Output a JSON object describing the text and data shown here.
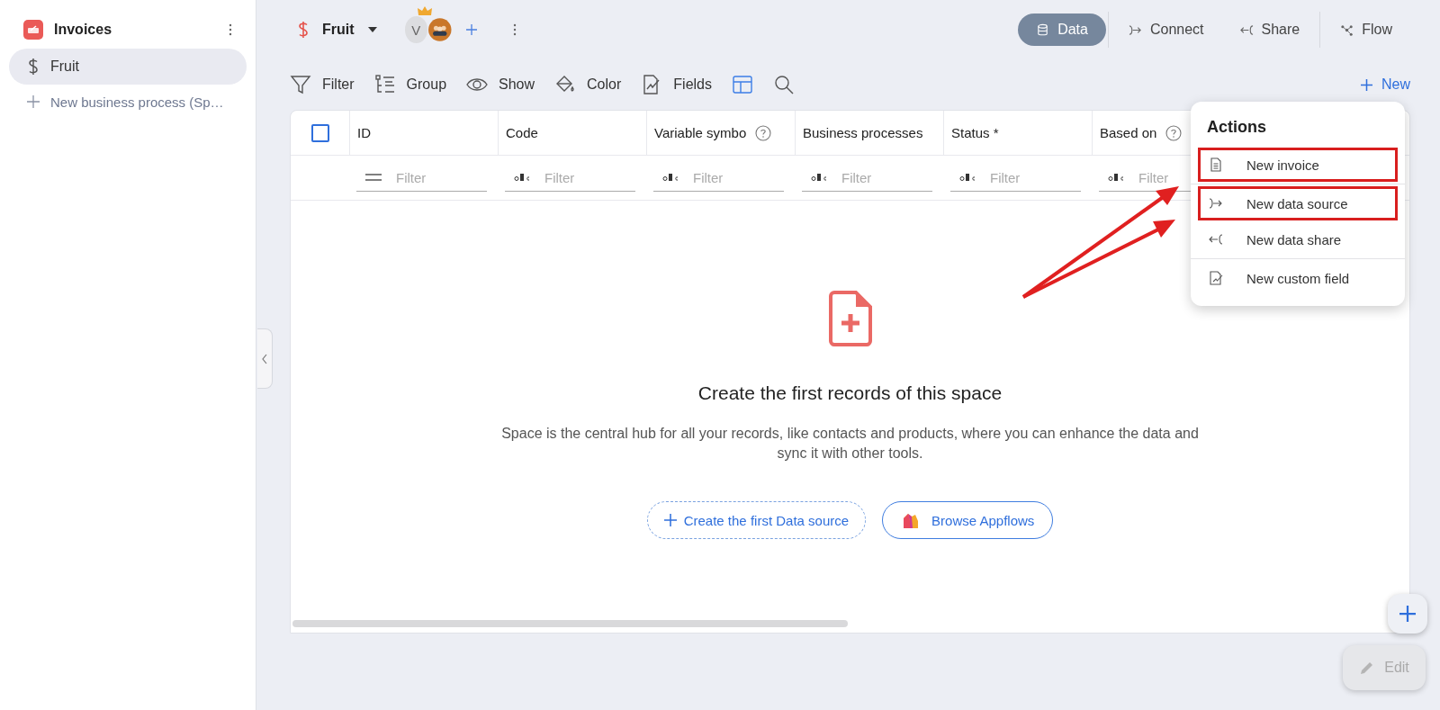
{
  "sidebar": {
    "app": {
      "title": "Invoices"
    },
    "items": [
      {
        "label": "Fruit",
        "selected": true
      }
    ],
    "new_item": {
      "label": "New business process (Sp…"
    }
  },
  "header": {
    "space": {
      "title": "Fruit"
    },
    "avatar": {
      "initial": "V"
    },
    "views": [
      {
        "label": "Data",
        "kind": "data",
        "selected": true
      },
      {
        "label": "Connect",
        "kind": "connect",
        "selected": false
      },
      {
        "label": "Share",
        "kind": "share",
        "selected": false
      },
      {
        "label": "Flow",
        "kind": "flow",
        "selected": false
      }
    ]
  },
  "toolbar": {
    "tools": [
      {
        "label": "Filter",
        "kind": "filter"
      },
      {
        "label": "Group",
        "kind": "group"
      },
      {
        "label": "Show",
        "kind": "show"
      },
      {
        "label": "Color",
        "kind": "color"
      },
      {
        "label": "Fields",
        "kind": "fields"
      },
      {
        "kind": "layout"
      },
      {
        "kind": "search"
      }
    ],
    "new_button": "New"
  },
  "table": {
    "select_all": {
      "checked": false
    },
    "columns": [
      {
        "title": "ID",
        "help": false,
        "filter": {
          "kind": "list",
          "placeholder": "Filter"
        }
      },
      {
        "title": "Code",
        "help": false,
        "filter": {
          "kind": "text",
          "placeholder": "Filter"
        }
      },
      {
        "title": "Variable symbo",
        "help": true,
        "filter": {
          "kind": "text",
          "placeholder": "Filter"
        }
      },
      {
        "title": "Business processes",
        "help": false,
        "filter": {
          "kind": "text",
          "placeholder": "Filter"
        }
      },
      {
        "title": "Status *",
        "help": false,
        "filter": {
          "kind": "text",
          "placeholder": "Filter"
        }
      },
      {
        "title": "Based on",
        "help": true,
        "filter": {
          "kind": "text",
          "placeholder": "Filter"
        }
      }
    ]
  },
  "empty_state": {
    "title": "Create the first records of this space",
    "description": "Space is the central hub for all your records, like contacts and products, where you can enhance the data and sync it with other tools.",
    "primary_button": "Create the first Data source",
    "secondary_button": "Browse Appflows"
  },
  "menu": {
    "title": "Actions",
    "groups": [
      [
        {
          "label": "New invoice",
          "kind": "invoice",
          "highlighted": true
        }
      ],
      [
        {
          "label": "New data source",
          "kind": "source",
          "highlighted": true
        },
        {
          "label": "New data share",
          "kind": "share",
          "highlighted": false
        }
      ],
      [
        {
          "label": "New custom field",
          "kind": "field",
          "highlighted": false
        }
      ]
    ]
  },
  "edit_button": {
    "label": "Edit",
    "disabled": true
  }
}
